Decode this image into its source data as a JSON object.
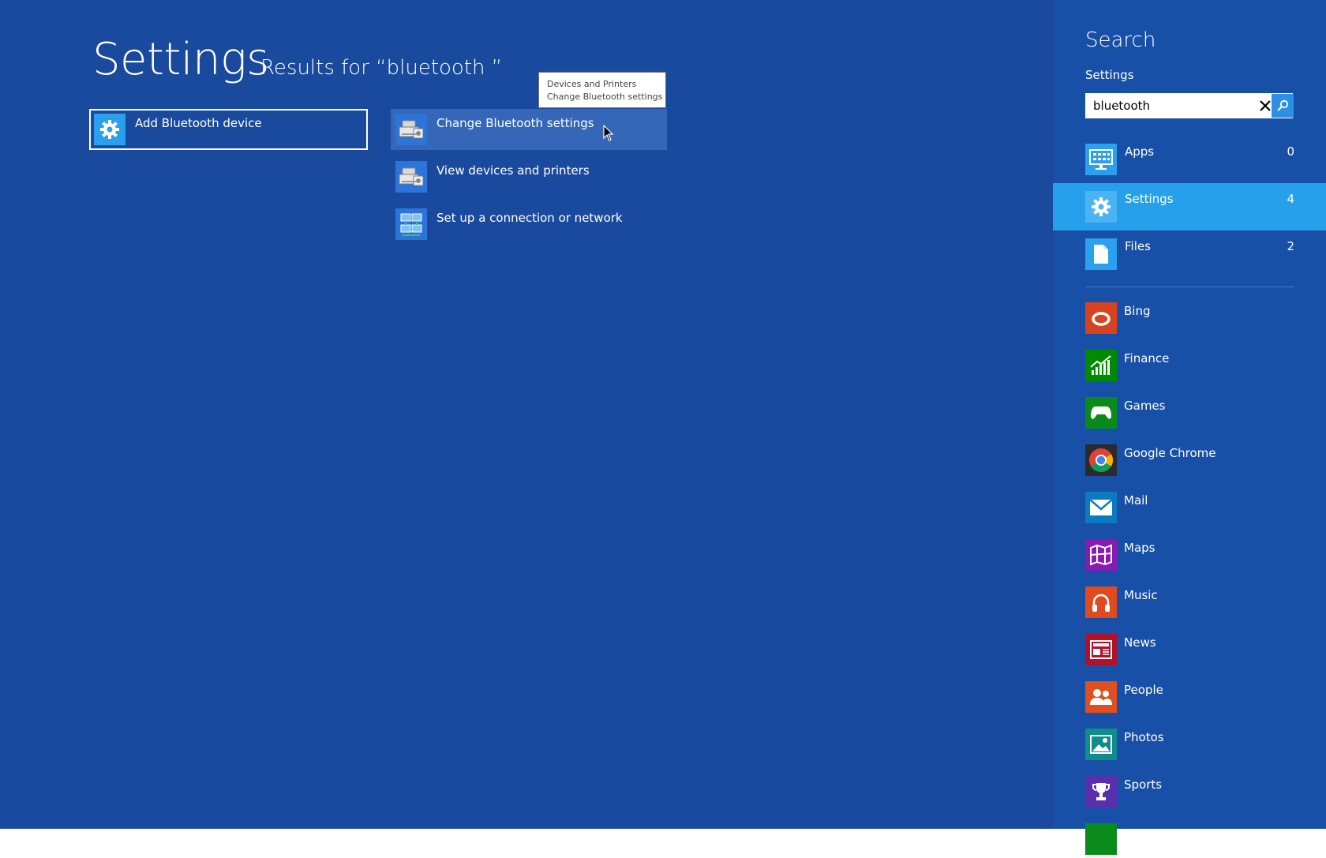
{
  "main": {
    "title": "Settings",
    "results_for": "Results for “bluetooth ”",
    "results": [
      {
        "label": "Add Bluetooth device",
        "icon": "gear-icon"
      },
      {
        "label": "Change Bluetooth settings",
        "icon": "devices-printers-icon"
      },
      {
        "label": "View devices and printers",
        "icon": "devices-printers-icon"
      },
      {
        "label": "Set up a connection or network",
        "icon": "network-icon"
      }
    ],
    "tooltip": {
      "line1": "Devices and Printers",
      "line2": "Change Bluetooth settings"
    }
  },
  "search_pane": {
    "title": "Search",
    "scope": "Settings",
    "query": "bluetooth",
    "scopes": [
      {
        "label": "Apps",
        "count": "0",
        "icon": "apps-icon",
        "active": false
      },
      {
        "label": "Settings",
        "count": "4",
        "icon": "gear-icon",
        "active": true
      },
      {
        "label": "Files",
        "count": "2",
        "icon": "file-icon",
        "active": false
      }
    ],
    "apps": [
      {
        "label": "Bing",
        "icon": "bing-icon",
        "color": "#d7431f"
      },
      {
        "label": "Finance",
        "icon": "finance-icon",
        "color": "#008a00"
      },
      {
        "label": "Games",
        "icon": "games-icon",
        "color": "#0a8a1a"
      },
      {
        "label": "Google Chrome",
        "icon": "chrome-icon",
        "color": "#2b2b2b"
      },
      {
        "label": "Mail",
        "icon": "mail-icon",
        "color": "#0a7bc1"
      },
      {
        "label": "Maps",
        "icon": "maps-icon",
        "color": "#8b1ab3"
      },
      {
        "label": "Music",
        "icon": "music-icon",
        "color": "#e04a1e"
      },
      {
        "label": "News",
        "icon": "news-icon",
        "color": "#b0122c"
      },
      {
        "label": "People",
        "icon": "people-icon",
        "color": "#e0501e"
      },
      {
        "label": "Photos",
        "icon": "photos-icon",
        "color": "#0f8c8c"
      },
      {
        "label": "Sports",
        "icon": "sports-icon",
        "color": "#5a2fae"
      }
    ]
  },
  "colors": {
    "background": "#1a4a9d",
    "pane": "#1850a8",
    "accent": "#27a0ec"
  }
}
